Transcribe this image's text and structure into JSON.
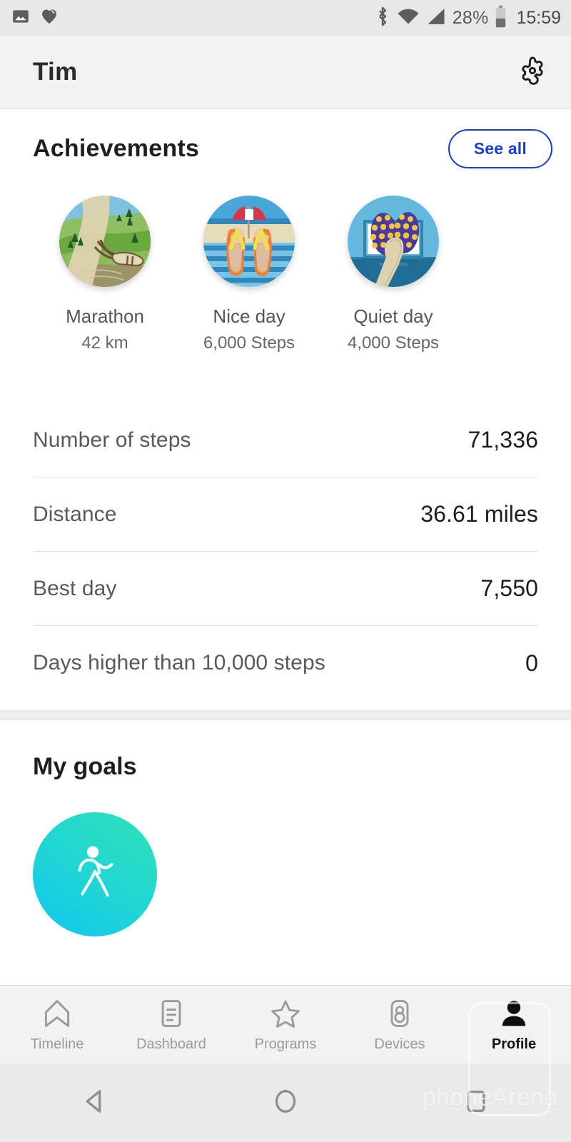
{
  "status_bar": {
    "left_icons": [
      "image-icon",
      "heart-health-icon"
    ],
    "bluetooth_icon": "bluetooth-icon",
    "wifi_icon": "wifi-icon",
    "signal_icon": "cellular-signal-icon",
    "battery_percent": "28%",
    "battery_icon": "battery-icon",
    "time": "15:59"
  },
  "header": {
    "title": "Tim",
    "settings_icon": "gear-icon"
  },
  "achievements": {
    "title": "Achievements",
    "see_all_label": "See all",
    "items": [
      {
        "name": "Marathon",
        "sub": "42 km",
        "art": "marathon-hills-shoe"
      },
      {
        "name": "Nice day",
        "sub": "6,000 Steps",
        "art": "beach-flipflops"
      },
      {
        "name": "Quiet day",
        "sub": "4,000 Steps",
        "art": "slippers-tv"
      }
    ]
  },
  "stats": {
    "rows": [
      {
        "label": "Number of steps",
        "value": "71,336"
      },
      {
        "label": "Distance",
        "value": "36.61 miles"
      },
      {
        "label": "Best day",
        "value": "7,550"
      },
      {
        "label": "Days higher than 10,000 steps",
        "value": "0"
      }
    ]
  },
  "goals": {
    "title": "My goals",
    "items": [
      {
        "icon": "walking-person-icon",
        "color_from": "#2fe0b6",
        "color_to": "#11c6ef"
      }
    ]
  },
  "tabbar": {
    "tabs": [
      {
        "label": "Timeline",
        "icon": "bookmark-icon",
        "active": false
      },
      {
        "label": "Dashboard",
        "icon": "list-card-icon",
        "active": false
      },
      {
        "label": "Programs",
        "icon": "star-icon",
        "active": false
      },
      {
        "label": "Devices",
        "icon": "watch-icon",
        "active": false
      },
      {
        "label": "Profile",
        "icon": "person-icon",
        "active": true
      }
    ]
  },
  "navbar": {
    "back_icon": "back-triangle-icon",
    "home_icon": "home-circle-icon",
    "recents_icon": "recents-square-icon"
  },
  "watermark": {
    "text": "phoneArena"
  },
  "colors": {
    "accent_blue": "#1b3fce",
    "status_bar_bg": "#e8e8e8",
    "header_bg": "#f2f2f2",
    "goal_gradient_from": "#2fe0b6",
    "goal_gradient_to": "#11c6ef"
  }
}
